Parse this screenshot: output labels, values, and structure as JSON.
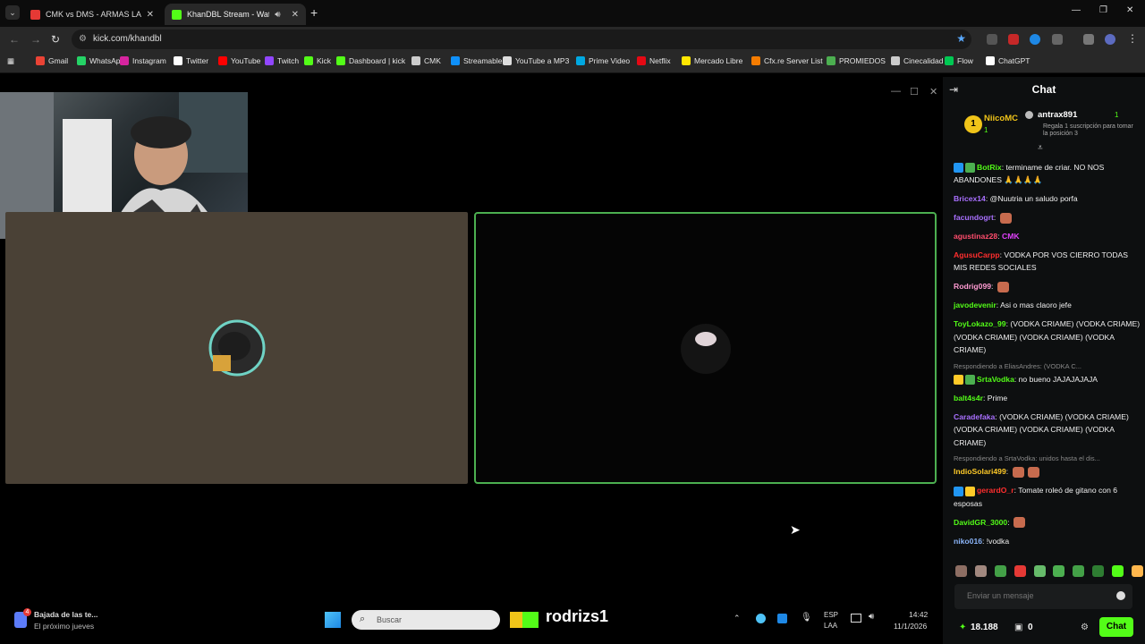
{
  "browser": {
    "tabs": [
      {
        "title": "CMK vs DMS - ARMAS LARGAS",
        "favicon_color": "#e53935"
      },
      {
        "title": "KhanDBL Stream - Watch L",
        "favicon_color": "#53fc18"
      }
    ],
    "url": "kick.com/khandbl",
    "bookmarks": [
      {
        "label": "Gmail",
        "icon": "gmail-icon",
        "color": "#ea4335"
      },
      {
        "label": "WhatsApp",
        "icon": "whatsapp-icon",
        "color": "#25d366"
      },
      {
        "label": "Instagram",
        "icon": "instagram-icon",
        "color": "#d6249f"
      },
      {
        "label": "Twitter",
        "icon": "x-icon",
        "color": "#ffffff"
      },
      {
        "label": "YouTube",
        "icon": "youtube-icon",
        "color": "#ff0000"
      },
      {
        "label": "Twitch",
        "icon": "twitch-icon",
        "color": "#9146ff"
      },
      {
        "label": "Kick",
        "icon": "kick-icon",
        "color": "#53fc18"
      },
      {
        "label": "Dashboard | kick",
        "icon": "kick-icon",
        "color": "#53fc18"
      },
      {
        "label": "CMK",
        "icon": "folder-icon",
        "color": "#cccccc"
      },
      {
        "label": "Streamable",
        "icon": "streamable-icon",
        "color": "#0f90fa"
      },
      {
        "label": "YouTube a MP3",
        "icon": "mp3-icon",
        "color": "#dddddd"
      },
      {
        "label": "Prime Video",
        "icon": "prime-icon",
        "color": "#00a8e1"
      },
      {
        "label": "Netflix",
        "icon": "netflix-icon",
        "color": "#e50914"
      },
      {
        "label": "Mercado Libre",
        "icon": "mercadolibre-icon",
        "color": "#ffe600"
      },
      {
        "label": "Cfx.re Server List",
        "icon": "cfx-icon",
        "color": "#f57c00"
      },
      {
        "label": "PROMIEDOS",
        "icon": "promiedos-icon",
        "color": "#4caf50"
      },
      {
        "label": "Cinecalidad",
        "icon": "cinecalidad-icon",
        "color": "#cccccc"
      },
      {
        "label": "Flow",
        "icon": "flow-icon",
        "color": "#00c853"
      },
      {
        "label": "ChatGPT",
        "icon": "chatgpt-icon",
        "color": "#ffffff"
      }
    ]
  },
  "chat": {
    "title": "Chat",
    "pinned": {
      "rank": "1",
      "user1": "NiicoMC",
      "user1_count": "1",
      "user2": "antrax891",
      "user2_count": "1",
      "note": "Regala 1 suscripción para tomar la posición 3"
    },
    "messages": [
      {
        "user": "BotRix",
        "color": "#53fc18",
        "text": "terminame de criar. NO NOS ABANDONES 🙏🙏🙏🙏",
        "badges": [
          "#2196f3",
          "#4caf50"
        ]
      },
      {
        "user": "Bricex14",
        "color": "#a970ff",
        "text": "@Nuutria un saludo porfa"
      },
      {
        "user": "facundogrt",
        "color": "#a970ff",
        "text": "",
        "emotes": 1
      },
      {
        "user": "agustinaz28",
        "color": "#ff4d6d",
        "text": "",
        "emote_text": "CMK"
      },
      {
        "user": "AgusuCarpp",
        "color": "#ff2e2e",
        "text": "VODKA POR VOS CIERRO TODAS MIS REDES SOCIALES"
      },
      {
        "user": "Rodrig099",
        "color": "#ff9bd2",
        "text": "",
        "emotes": 1
      },
      {
        "user": "javodevenir",
        "color": "#53fc18",
        "text": "Asi o mas claoro jefe"
      },
      {
        "user": "ToyLokazo_99",
        "color": "#53fc18",
        "text": "(VODKA CRIAME) (VODKA CRIAME) (VODKA CRIAME) (VODKA CRIAME) (VODKA CRIAME)"
      },
      {
        "reply": "Respondiendo a EliasAndres: (VODKA C..."
      },
      {
        "user": "SrtaVodka",
        "color": "#53fc18",
        "text": "no bueno JAJAJAJAJA",
        "badges": [
          "#ffca28",
          "#4caf50"
        ]
      },
      {
        "user": "balt4s4r",
        "color": "#53fc18",
        "text": "Prime"
      },
      {
        "user": "Caradefaka",
        "color": "#a970ff",
        "text": "(VODKA CRIAME) (VODKA CRIAME) (VODKA CRIAME) (VODKA CRIAME) (VODKA CRIAME)"
      },
      {
        "reply": "Respondiendo a SrtaVodka: unidos hasta el dis..."
      },
      {
        "user": "IndioSolari499",
        "color": "#ffca28",
        "text": "",
        "emotes": 2
      },
      {
        "user": "gerardO_r",
        "color": "#ff2e2e",
        "text": "Tomate roleó de gitano con 6 esposas",
        "badges": [
          "#2196f3",
          "#ffca28"
        ]
      },
      {
        "user": "DavidGR_3000",
        "color": "#53fc18",
        "text": "",
        "emotes": 1
      },
      {
        "user": "niko016",
        "color": "#8ab4f8",
        "text": "!vodka"
      }
    ],
    "input_placeholder": "Enviar un mensaje",
    "points": "18.188",
    "gifts": "0",
    "send_label": "Chat"
  },
  "taskbar": {
    "weather_title": "Bajada de las te...",
    "weather_sub": "El próximo jueves",
    "weather_badge": "4",
    "search_placeholder": "Buscar",
    "overlay_name": "rodrizs1",
    "lang": "ESP",
    "lang2": "LAA",
    "time": "14:42",
    "date": "11/1/2026"
  }
}
